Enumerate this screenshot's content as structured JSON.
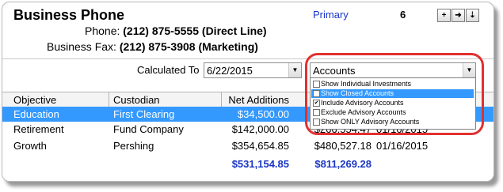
{
  "header": {
    "title": "Business Phone",
    "phone_label": "Phone:",
    "phone_value": "(212) 875-5555",
    "phone_type": "(Direct Line)",
    "fax_label": "Business Fax:",
    "fax_value": "(212) 875-3908",
    "fax_type": "(Marketing)",
    "primary_link": "Primary",
    "count": "6",
    "tool_buttons": [
      "+",
      "➜",
      "⇣"
    ]
  },
  "filters": {
    "calculated_label": "Calculated To",
    "date_value": "6/22/2015",
    "accounts_value": "Accounts",
    "dropdown_arrow": "▼",
    "options": [
      {
        "label": "Show Individual Investments",
        "checked": false,
        "selected": false
      },
      {
        "label": "Show Closed Accounts",
        "checked": false,
        "selected": true
      },
      {
        "label": "Include Advisory Accounts",
        "checked": true,
        "selected": false
      },
      {
        "label": "Exclude Advisory Accounts",
        "checked": false,
        "selected": false
      },
      {
        "label": "Show ONLY Advisory Accounts",
        "checked": false,
        "selected": false
      }
    ]
  },
  "table": {
    "columns": [
      "Objective",
      "Custodian",
      "Net Additions"
    ],
    "rows": [
      {
        "objective": "Education",
        "custodian": "First Clearing",
        "net_additions": "$34,500.00",
        "value": "",
        "date": ""
      },
      {
        "objective": "Retirement",
        "custodian": "Fund Company",
        "net_additions": "$142,000.00",
        "value": "$266,554.47",
        "date": "01/16/2015"
      },
      {
        "objective": "Growth",
        "custodian": "Pershing",
        "net_additions": "$354,654.85",
        "value": "$480,527.18",
        "date": "01/16/2015"
      }
    ],
    "totals": {
      "net_additions": "$531,154.85",
      "value": "$811,269.28"
    }
  },
  "colors": {
    "accent": "#1a36c4",
    "selection": "#3399ff",
    "highlight_oval": "#e23030"
  }
}
